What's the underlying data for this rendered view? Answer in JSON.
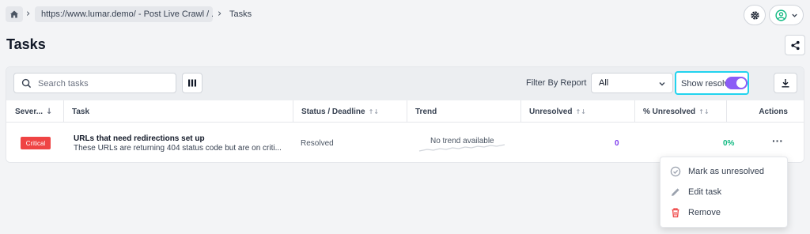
{
  "breadcrumb": {
    "project": "https://www.lumar.demo/ - Post Live Crawl / ...",
    "current": "Tasks"
  },
  "page": {
    "title": "Tasks"
  },
  "toolbar": {
    "search_placeholder": "Search tasks",
    "filter_label": "Filter By Report",
    "filter_value": "All",
    "show_resolved_label": "Show resolved",
    "show_resolved_on": true
  },
  "table": {
    "headers": {
      "severity": "Sever...",
      "task": "Task",
      "status": "Status / Deadline",
      "trend": "Trend",
      "unresolved": "Unresolved",
      "pct_unresolved": "% Unresolved",
      "actions": "Actions"
    },
    "rows": [
      {
        "severity": "Critical",
        "title": "URLs that need redirections set up",
        "description": "These URLs are returning 404 status code but are on criti...",
        "status": "Resolved",
        "trend": "No trend available",
        "unresolved": "0",
        "pct_unresolved": "0%",
        "actions": "···"
      }
    ]
  },
  "menu": {
    "items": [
      {
        "label": "Mark as unresolved",
        "icon": "check-circle-icon"
      },
      {
        "label": "Edit task",
        "icon": "pencil-icon"
      },
      {
        "label": "Remove",
        "icon": "trash-icon"
      }
    ]
  },
  "colors": {
    "accent_purple": "#8b5cf6",
    "highlight_cyan": "#22d3ee",
    "critical_red": "#ef4444",
    "success_green": "#10b981"
  }
}
